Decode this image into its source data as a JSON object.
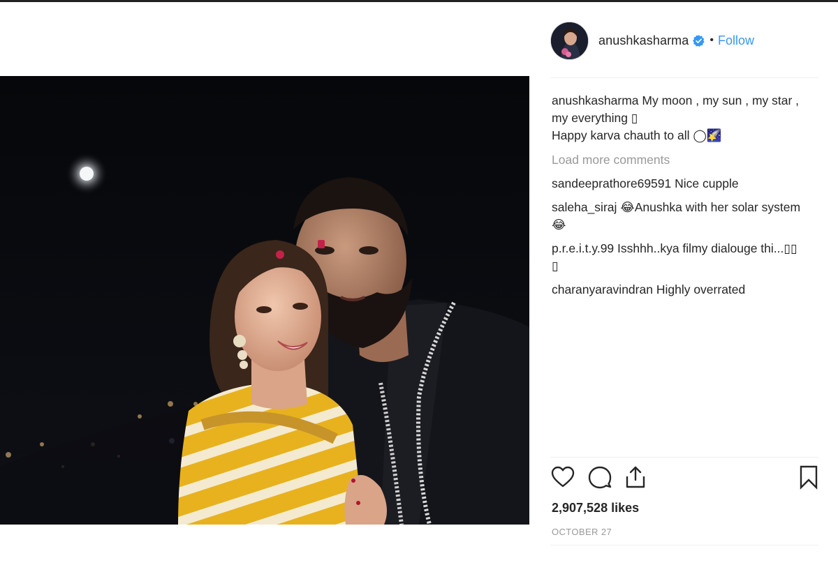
{
  "post": {
    "username": "anushkasharma",
    "follow_label": "Follow",
    "separator": "•",
    "caption": {
      "username": "anushkasharma",
      "line1": "My moon , my sun , my star ,",
      "line2": "my everything ▯",
      "line3": "Happy karva chauth to all ◯🌠"
    },
    "load_more_label": "Load more comments",
    "comments": [
      {
        "username": "sandeeprathore69591",
        "text": "Nice cupple"
      },
      {
        "username": "saleha_siraj",
        "text": "😂Anushka with her solar system",
        "cont": "😂"
      },
      {
        "username": "p.r.e.i.t.y.99",
        "text": "Isshhh..kya filmy dialouge thi...▯▯",
        "cont": "▯"
      },
      {
        "username": "charanyaravindran",
        "text": "Highly overrated"
      }
    ],
    "likes": "2,907,528 likes",
    "date": "OCTOBER 27"
  },
  "icons": {
    "like": "heart-icon",
    "comment": "comment-bubble-icon",
    "share": "share-upload-icon",
    "save": "bookmark-icon",
    "verified": "verified-badge-icon"
  },
  "colors": {
    "link_blue": "#3897f0",
    "verified_blue": "#3897f0",
    "muted_gray": "#999999",
    "text": "#262626"
  }
}
